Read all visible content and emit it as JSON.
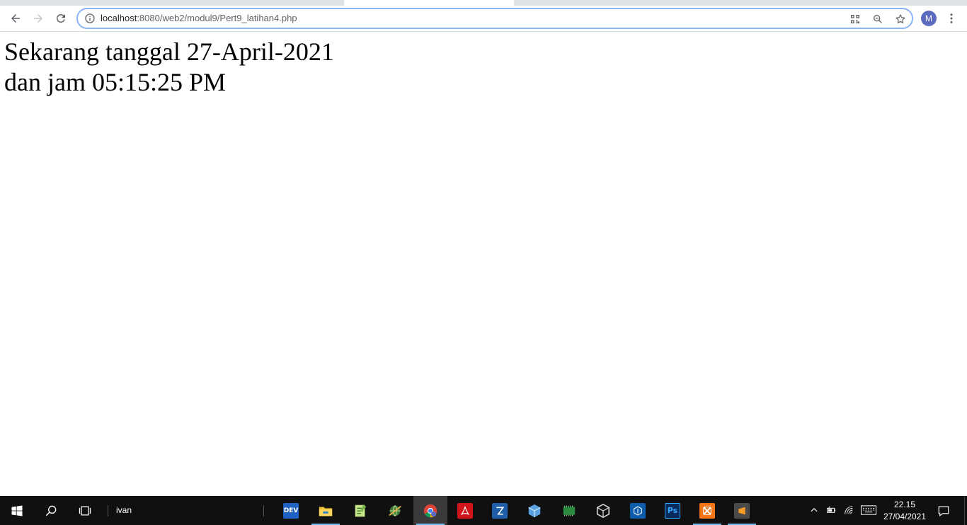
{
  "browser": {
    "url_host": "localhost",
    "url_rest": ":8080/web2/modul9/Pert9_latihan4.php",
    "avatar_letter": "M",
    "icons": [
      "back-icon",
      "forward-icon",
      "reload-icon",
      "info-icon",
      "qr-code-icon",
      "zoom-icon",
      "bookmark-star-icon",
      "kebab-menu-icon"
    ]
  },
  "page": {
    "line1": "Sekarang tanggal 27-April-2021",
    "line2": "dan jam 05:15:25 PM"
  },
  "taskbar": {
    "search_text": "ivan",
    "apps": [
      {
        "name": "devc",
        "label": "DEV",
        "color": "#1e63c4"
      },
      {
        "name": "file-explorer",
        "label": "",
        "color": "#f3c33c"
      },
      {
        "name": "notepad-plus",
        "label": "",
        "color": "#7ab648"
      },
      {
        "name": "app-globe",
        "label": "",
        "color": "#3c7a3c"
      },
      {
        "name": "chrome",
        "label": "",
        "color": "#db4437"
      },
      {
        "name": "acrobat",
        "label": "",
        "color": "#d1161b"
      },
      {
        "name": "filezilla",
        "label": "",
        "color": "#1f5fa8"
      },
      {
        "name": "virtualbox-cube",
        "label": "",
        "color": "#5aa0e0"
      },
      {
        "name": "memory-app",
        "label": "",
        "color": "#2b8a3e"
      },
      {
        "name": "unity",
        "label": "",
        "color": "#d0d0d0"
      },
      {
        "name": "code-editor",
        "label": "",
        "color": "#0d5cab"
      },
      {
        "name": "photoshop",
        "label": "Ps",
        "color": "#0a2a5c"
      },
      {
        "name": "xampp",
        "label": "",
        "color": "#f5761a"
      },
      {
        "name": "sublime-text",
        "label": "",
        "color": "#f59a23"
      }
    ],
    "clock_time": "22.15",
    "clock_date": "27/04/2021"
  }
}
